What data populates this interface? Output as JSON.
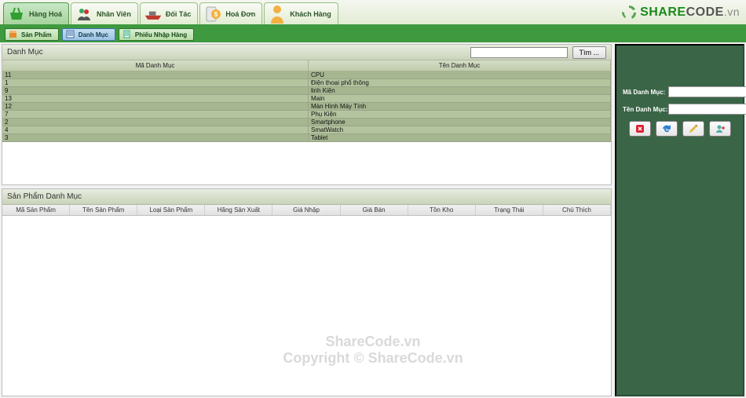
{
  "logo": {
    "textA": "SHARE",
    "textB": "CODE",
    "suffix": ".vn"
  },
  "nav": {
    "tabs": [
      {
        "label": "Hàng Hoá",
        "icon": "basket"
      },
      {
        "label": "Nhân Viên",
        "icon": "people"
      },
      {
        "label": "Đối Tác",
        "icon": "ship"
      },
      {
        "label": "Hoá Đơn",
        "icon": "invoice"
      },
      {
        "label": "Khách Hàng",
        "icon": "person"
      }
    ],
    "selected": 0
  },
  "subnav": {
    "tabs": [
      {
        "label": "Sản Phẩm"
      },
      {
        "label": "Danh Mục"
      },
      {
        "label": "Phiếu Nhập Hàng"
      }
    ],
    "selected": 1
  },
  "search": {
    "placeholder": "",
    "button": "Tìm ..."
  },
  "cat_panel": {
    "title": "Danh Mục",
    "columns": [
      "Mã Danh Mục",
      "Tên Danh Mục"
    ],
    "rows": [
      {
        "ma": "11",
        "ten": "CPU"
      },
      {
        "ma": "1",
        "ten": "Điện thoại phổ thông"
      },
      {
        "ma": "9",
        "ten": "linh Kiện"
      },
      {
        "ma": "13",
        "ten": "Main"
      },
      {
        "ma": "12",
        "ten": "Màn Hình Máy Tính"
      },
      {
        "ma": "7",
        "ten": "Phụ Kiện"
      },
      {
        "ma": "2",
        "ten": "Smartphone"
      },
      {
        "ma": "4",
        "ten": "SmatWatch"
      },
      {
        "ma": "3",
        "ten": "Tablet"
      }
    ]
  },
  "prod_panel": {
    "title": "Sản Phẩm Danh Mục",
    "columns": [
      "Mã Sản Phẩm",
      "Tên Sản Phẩm",
      "Loại Sản Phẩm",
      "Hãng Sản Xuất",
      "Giá Nhập",
      "Giá Bán",
      "Tồn Kho",
      "Trạng Thái",
      "Chú Thích"
    ]
  },
  "sidebar": {
    "fields": [
      {
        "label": "Mã Danh Mục:"
      },
      {
        "label": "Tên Danh Mục:"
      }
    ],
    "actions": [
      "delete",
      "refresh",
      "edit",
      "add"
    ]
  },
  "watermark": "Copyright © ShareCode.vn"
}
